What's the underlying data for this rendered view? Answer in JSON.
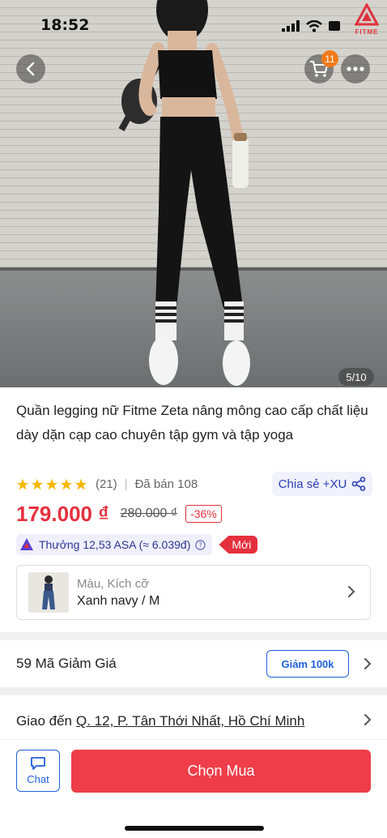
{
  "status_bar": {
    "time": "18:52"
  },
  "brand": {
    "logo_text": "FITME"
  },
  "cart": {
    "badge_count": "11"
  },
  "gallery": {
    "counter": "5/10"
  },
  "product": {
    "title": "Quần legging nữ Fitme Zeta nâng mông cao cấp chất liệu dày dặn cạp cao chuyên tập gym và tập yoga",
    "rating_stars": 5,
    "review_count": "(21)",
    "sold_text": "Đã bán 108",
    "share_label": "Chia sẻ +XU",
    "price": "179.000 ₫",
    "old_price": "280.000 ₫",
    "discount": "-36%",
    "reward_text": "Thưởng 12,53 ASA (≈ 6.039đ)",
    "new_tag": "Mới"
  },
  "variant": {
    "label": "Màu, Kích cỡ",
    "value": "Xanh navy / M"
  },
  "voucher": {
    "label": "59 Mã Giảm Giá",
    "tag": "Giảm 100k"
  },
  "shipping": {
    "prefix": "Giao đến",
    "address": "Q. 12, P. Tân Thới Nhất, Hồ Chí Minh"
  },
  "bottom_bar": {
    "chat_label": "Chat",
    "buy_label": "Chọn Mua"
  },
  "colors": {
    "accent_red": "#ef3d4a",
    "price_red": "#e5303d",
    "link_blue": "#2060d8",
    "badge_orange": "#f27a1a",
    "star_yellow": "#f5b800"
  }
}
